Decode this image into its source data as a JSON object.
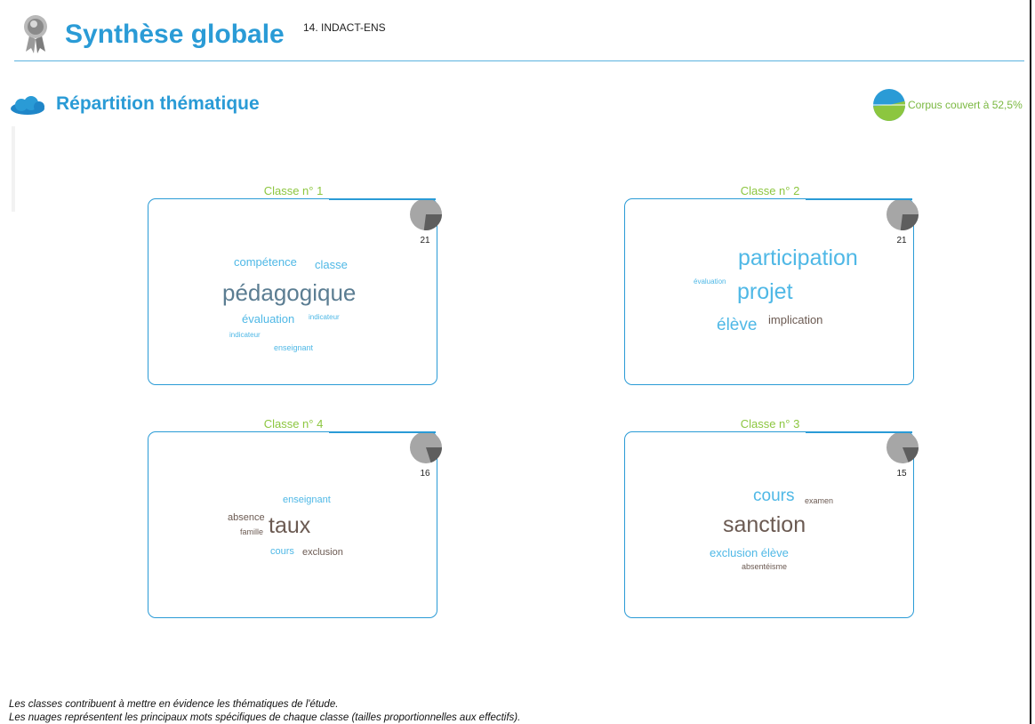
{
  "header": {
    "title": "Synthèse globale",
    "subtitle": "14. INDACT-ENS"
  },
  "section": {
    "title": "Répartition thématique",
    "coverage_label": "Corpus couvert à 52,5%",
    "coverage_pct": 52.5
  },
  "colors": {
    "accent_blue": "#2a9bd6",
    "accent_green": "#8cc63f",
    "word_blue": "#4fb8e6",
    "word_slate": "#5b7d92",
    "word_brown": "#6b5a52"
  },
  "icons": {
    "header": "award-ribbon-icon",
    "section": "cloud-icon",
    "coverage": "pie-chart-icon"
  },
  "classes": [
    {
      "title": "Classe n° 1",
      "count": "21",
      "share": 0.27,
      "words": [
        {
          "text": "compétence"
        },
        {
          "text": "classe"
        },
        {
          "text": "pédagogique"
        },
        {
          "text": "évaluation"
        },
        {
          "text": "indicateur"
        },
        {
          "text": "indicateur"
        },
        {
          "text": "enseignant"
        }
      ]
    },
    {
      "title": "Classe n° 2",
      "count": "21",
      "share": 0.27,
      "words": [
        {
          "text": "participation"
        },
        {
          "text": "évaluation"
        },
        {
          "text": "projet"
        },
        {
          "text": "élève"
        },
        {
          "text": "implication"
        }
      ]
    },
    {
      "title": "Classe n° 4",
      "count": "16",
      "share": 0.2,
      "words": [
        {
          "text": "enseignant"
        },
        {
          "text": "absence"
        },
        {
          "text": "famille"
        },
        {
          "text": "taux"
        },
        {
          "text": "cours"
        },
        {
          "text": "exclusion"
        }
      ]
    },
    {
      "title": "Classe n° 3",
      "count": "15",
      "share": 0.19,
      "words": [
        {
          "text": "cours"
        },
        {
          "text": "examen"
        },
        {
          "text": "sanction"
        },
        {
          "text": "exclusion élève"
        },
        {
          "text": "absentéisme"
        }
      ]
    }
  ],
  "footer": {
    "line1": "Les classes contribuent à mettre en évidence les thématiques de l'étude.",
    "line2": "Les nuages représentent les principaux mots spécifiques de chaque classe (tailles proportionnelles aux effectifs)."
  }
}
